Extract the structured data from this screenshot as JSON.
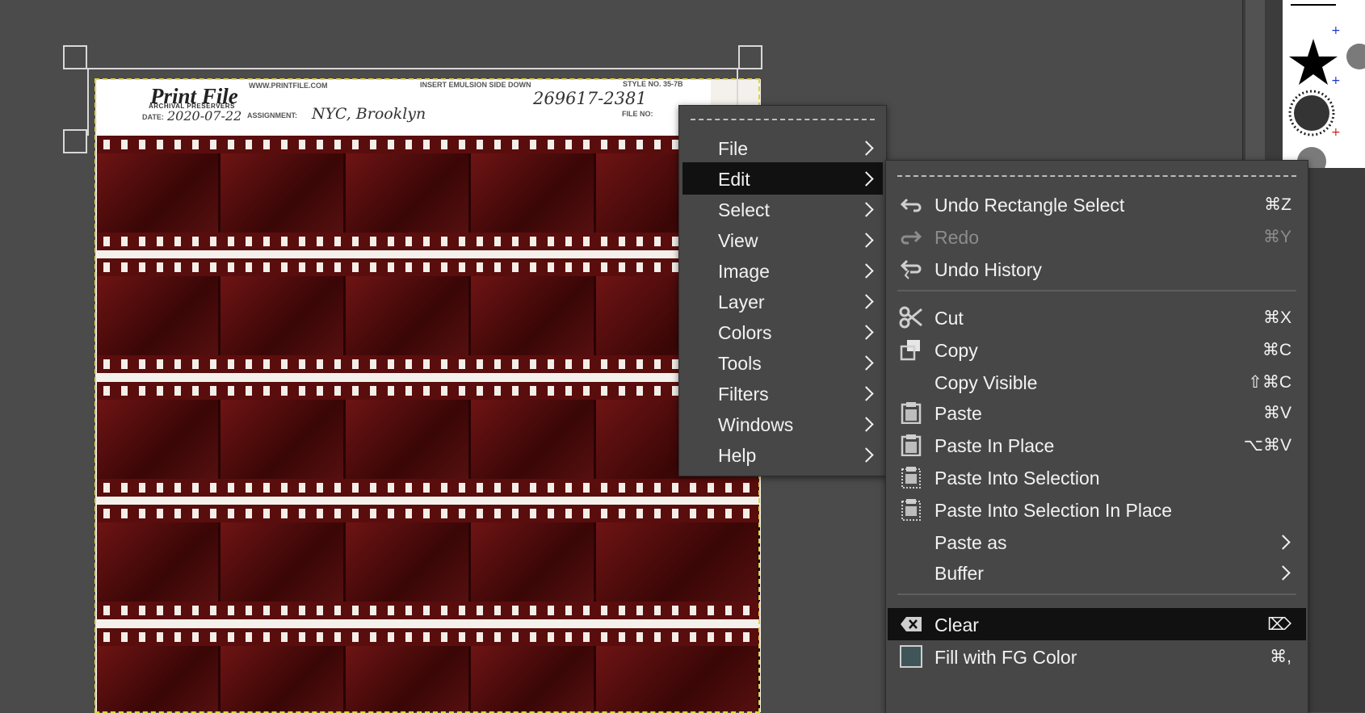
{
  "image_header": {
    "logo": "Print File",
    "logo_sub": "ARCHIVAL PRESERVERS",
    "website": "WWW.PRINTFILE.COM",
    "insert_note": "INSERT EMULSION SIDE DOWN",
    "style_no": "STYLE NO. 35-7B",
    "date_label": "DATE:",
    "date_value": "2020-07-22",
    "assignment_label": "ASSIGNMENT:",
    "assignment_value": "NYC, Brooklyn",
    "file_label": "FILE NO:",
    "file_value": "269617-2381"
  },
  "main_menu": {
    "items": [
      {
        "label": "File"
      },
      {
        "label": "Edit"
      },
      {
        "label": "Select"
      },
      {
        "label": "View"
      },
      {
        "label": "Image"
      },
      {
        "label": "Layer"
      },
      {
        "label": "Colors"
      },
      {
        "label": "Tools"
      },
      {
        "label": "Filters"
      },
      {
        "label": "Windows"
      },
      {
        "label": "Help"
      }
    ],
    "active": "Edit"
  },
  "edit_menu": {
    "items": [
      {
        "label": "Undo Rectangle Select",
        "shortcut": "⌘Z",
        "icon": "undo-icon"
      },
      {
        "label": "Redo",
        "shortcut": "⌘Y",
        "icon": "redo-icon",
        "disabled": true
      },
      {
        "label": "Undo History",
        "shortcut": "",
        "icon": "undo-history-icon"
      },
      {
        "label": "Cut",
        "shortcut": "⌘X",
        "icon": "scissors-icon"
      },
      {
        "label": "Copy",
        "shortcut": "⌘C",
        "icon": "copy-icon"
      },
      {
        "label": "Copy Visible",
        "shortcut": "⇧⌘C",
        "icon": ""
      },
      {
        "label": "Paste",
        "shortcut": "⌘V",
        "icon": "clipboard-icon"
      },
      {
        "label": "Paste In Place",
        "shortcut": "⌥⌘V",
        "icon": "clipboard-icon"
      },
      {
        "label": "Paste Into Selection",
        "shortcut": "",
        "icon": "paste-into-selection-icon"
      },
      {
        "label": "Paste Into Selection In Place",
        "shortcut": "",
        "icon": "paste-into-selection-icon"
      },
      {
        "label": "Paste as",
        "shortcut": "",
        "icon": "",
        "submenu": true
      },
      {
        "label": "Buffer",
        "shortcut": "",
        "icon": "",
        "submenu": true
      },
      {
        "label": "Clear",
        "shortcut": "⌦",
        "icon": "clear-icon",
        "active": true
      },
      {
        "label": "Fill with FG Color",
        "shortcut": "⌘,",
        "icon": "fg-color-swatch-icon"
      }
    ]
  },
  "colors": {
    "menu_bg": "#474747",
    "active_bg": "#111111",
    "film": "#5a0d0d",
    "fg_swatch": "#3f5558",
    "selection_dash": "#e3d23a"
  }
}
